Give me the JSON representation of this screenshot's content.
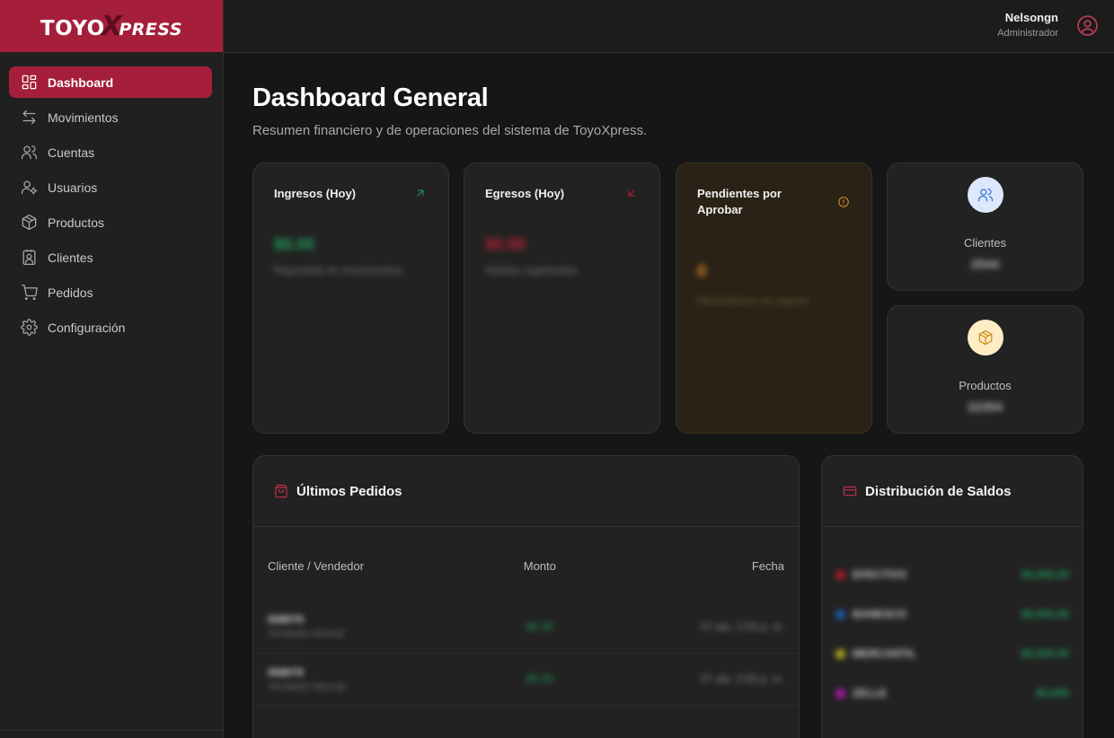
{
  "brand": {
    "logo_a": "TOYO",
    "logo_x": "X",
    "logo_b": "PRESS"
  },
  "sidebar": {
    "items": [
      {
        "label": "Dashboard",
        "icon": "grid-icon"
      },
      {
        "label": "Movimientos",
        "icon": "arrows-icon"
      },
      {
        "label": "Cuentas",
        "icon": "users-icon"
      },
      {
        "label": "Usuarios",
        "icon": "user-cog-icon"
      },
      {
        "label": "Productos",
        "icon": "package-icon"
      },
      {
        "label": "Clientes",
        "icon": "contact-icon"
      },
      {
        "label": "Pedidos",
        "icon": "cart-icon"
      },
      {
        "label": "Configuración",
        "icon": "gear-icon"
      }
    ]
  },
  "header": {
    "user_name": "Nelsongn",
    "user_role": "Administrador"
  },
  "page": {
    "title": "Dashboard General",
    "subtitle": "Resumen financiero y de operaciones del sistema de ToyoXpress."
  },
  "cards": {
    "ingresos": {
      "title": "Ingresos (Hoy)",
      "value": "$0.00",
      "note": "Reportado en movimientos"
    },
    "egresos": {
      "title": "Egresos (Hoy)",
      "value": "$0.00",
      "note": "Salidas registradas"
    },
    "pendientes": {
      "title": "Pendientes por Aprobar",
      "value": "0",
      "note": "Movimientos en espera"
    },
    "clientes": {
      "label": "Clientes",
      "value": "2544"
    },
    "productos": {
      "label": "Productos",
      "value": "22354"
    }
  },
  "orders": {
    "title": "Últimos Pedidos",
    "columns": [
      "Cliente / Vendedor",
      "Monto",
      "Fecha"
    ],
    "rows": [
      {
        "id": "008070",
        "sub": "Vendedor Ahmed",
        "amount": "$0.00",
        "date": "07 abr, 2:55 p. m."
      },
      {
        "id": "008070",
        "sub": "Vendedor Marzap",
        "amount": "$0.00",
        "date": "07 abr, 2:55 p. m."
      }
    ]
  },
  "balances": {
    "title": "Distribución de Saldos",
    "rows": [
      {
        "name": "EFECTIVO",
        "value": "$0,000.00",
        "color": "#b01a2a"
      },
      {
        "name": "BANESCO",
        "value": "$0,000.00",
        "color": "#1d5fb0"
      },
      {
        "name": "MERCANTIL",
        "value": "$0,000.00",
        "color": "#b0b01a"
      },
      {
        "name": "ZELLE",
        "value": "$0,000",
        "color": "#b01ab0"
      }
    ]
  },
  "colors": {
    "accent": "#a51f3a",
    "green": "#1f9c5a",
    "amber": "#e0902a"
  }
}
